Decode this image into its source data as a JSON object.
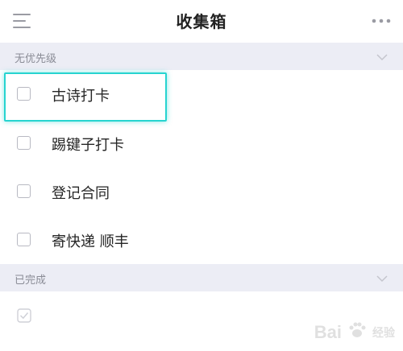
{
  "header": {
    "title": "收集箱",
    "menu_icon": "hamburger-menu-icon",
    "more_icon": "more-dots-icon"
  },
  "sections": {
    "no_priority": {
      "label": "无优先级"
    },
    "completed": {
      "label": "已完成"
    }
  },
  "tasks": [
    {
      "label": "古诗打卡",
      "checked": false
    },
    {
      "label": "踢键子打卡",
      "checked": false
    },
    {
      "label": "登记合同",
      "checked": false
    },
    {
      "label": "寄快递 顺丰",
      "checked": false
    }
  ],
  "completed_items": [
    {
      "checked": true
    }
  ],
  "watermark": {
    "text": "Bai",
    "sub": "经验"
  },
  "colors": {
    "section_bg": "#ecedf5",
    "highlight": "#27d4d0",
    "muted_text": "#8a8c96"
  }
}
